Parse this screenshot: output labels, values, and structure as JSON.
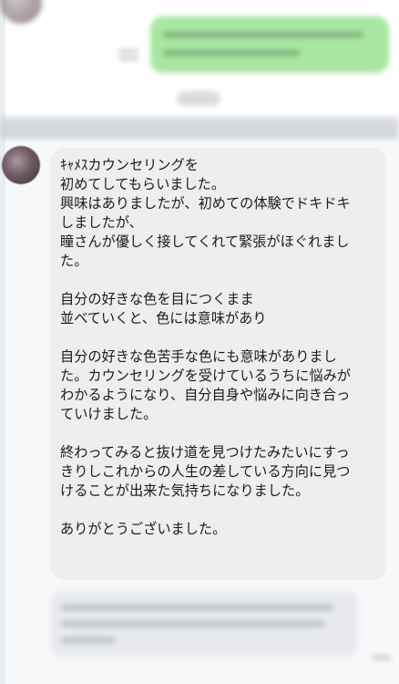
{
  "message": {
    "lines": [
      "ｷｬﾒｽカウンセリングを",
      "初めてしてもらいました。",
      "興味はありましたが、初めての体験でドキドキ",
      "しましたが、",
      "瞳さんが優しく接してくれて緊張がほぐれまし",
      "た。",
      "",
      "自分の好きな色を目につくまま",
      "並べていくと、色には意味があり",
      "",
      "自分の好きな色苦手な色にも意味がありまし",
      "た。カウンセリングを受けているうちに悩みが",
      "わかるようになり、自分自身や悩みに向き合っ",
      "ていけました。",
      "",
      "終わってみると抜け道を見つけたみたいにすっ",
      "きりしこれからの人生の差している方向に見つ",
      "けることが出来た気持ちになりました。",
      "",
      "ありがとうございました。"
    ]
  },
  "colors": {
    "sent_bubble": "#a8e6a1",
    "received_bubble": "#edeef0",
    "text": "#1b1b1b"
  }
}
